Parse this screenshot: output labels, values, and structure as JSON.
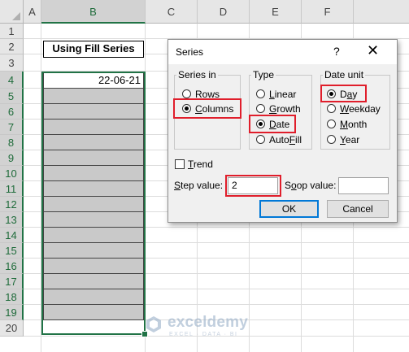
{
  "spreadsheet": {
    "columns": [
      "A",
      "B",
      "C",
      "D",
      "E",
      "F"
    ],
    "rows": [
      "1",
      "2",
      "3",
      "4",
      "5",
      "6",
      "7",
      "8",
      "9",
      "10",
      "11",
      "12",
      "13",
      "14",
      "15",
      "16",
      "17",
      "18",
      "19",
      "20"
    ],
    "title_cell": "Using Fill Series",
    "first_date": "22-06-21"
  },
  "dialog": {
    "title": "Series",
    "help": "?",
    "close": "✕",
    "series_in": {
      "label": "Series in",
      "options": [
        {
          "label": "Rows",
          "selected": false
        },
        {
          "label": "Columns",
          "selected": true
        }
      ]
    },
    "type": {
      "label": "Type",
      "options": [
        {
          "label": "Linear",
          "selected": false
        },
        {
          "label": "Growth",
          "selected": false
        },
        {
          "label": "Date",
          "selected": true
        },
        {
          "label": "AutoFill",
          "selected": false
        }
      ]
    },
    "date_unit": {
      "label": "Date unit",
      "options": [
        {
          "label": "Day",
          "selected": true
        },
        {
          "label": "Weekday",
          "selected": false
        },
        {
          "label": "Month",
          "selected": false
        },
        {
          "label": "Year",
          "selected": false
        }
      ]
    },
    "trend_label": "Trend",
    "step_label": "Step value:",
    "step_value": "2",
    "stop_label": "Stop value:",
    "stop_value": "",
    "ok_label": "OK",
    "cancel_label": "Cancel"
  },
  "watermark": {
    "name": "exceldemy",
    "tagline": "EXCEL · DATA · BI"
  },
  "colors": {
    "excel_green": "#217346",
    "highlight_red": "#e01e2b",
    "selection_fill": "#c9c9c9"
  }
}
